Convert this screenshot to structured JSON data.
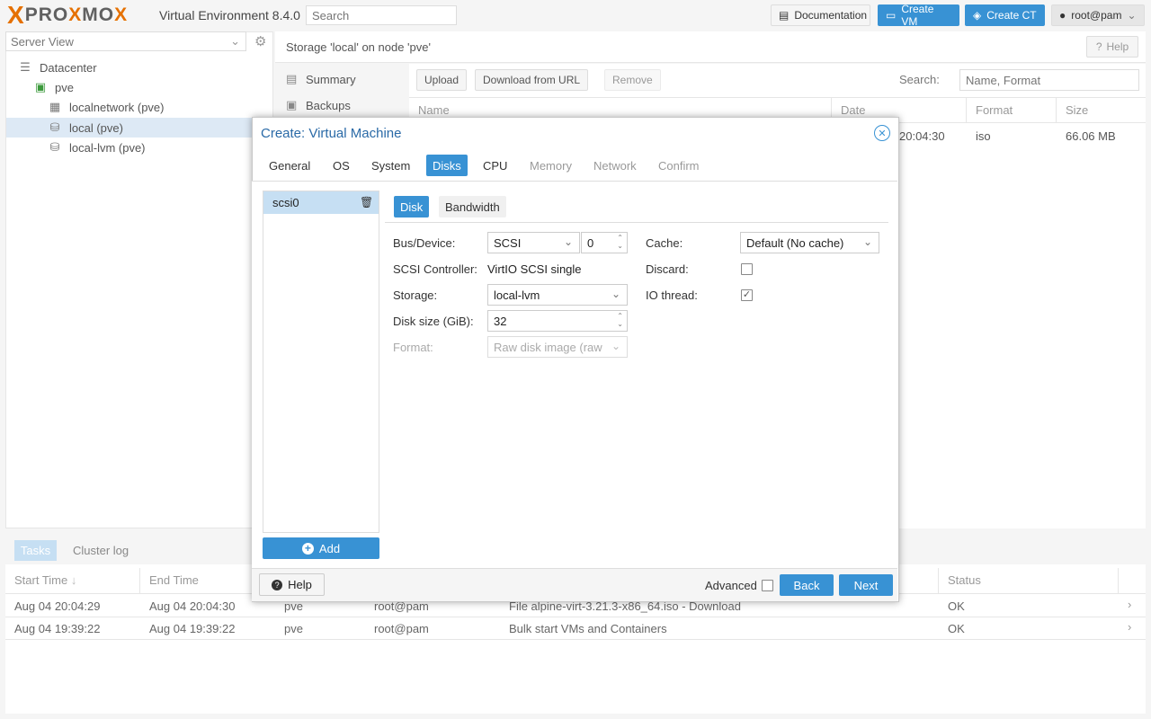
{
  "topbar": {
    "logo_x": "X",
    "brand": "PROXMOX",
    "version": "Virtual Environment 8.4.0",
    "search_placeholder": "Search",
    "documentation": "Documentation",
    "create_vm": "Create VM",
    "create_ct": "Create CT",
    "user": "root@pam"
  },
  "sidebar": {
    "view": "Server View",
    "tree": [
      {
        "label": "Datacenter",
        "icon": "server-rack-icon"
      },
      {
        "label": "pve",
        "icon": "node-icon"
      },
      {
        "label": "localnetwork (pve)",
        "icon": "network-grid-icon"
      },
      {
        "label": "local (pve)",
        "icon": "storage-icon"
      },
      {
        "label": "local-lvm (pve)",
        "icon": "storage-icon"
      }
    ]
  },
  "content": {
    "breadcrumb": "Storage 'local' on node 'pve'",
    "help": "Help",
    "nav": [
      {
        "label": "Summary",
        "icon": "book-icon"
      },
      {
        "label": "Backups",
        "icon": "floppy-icon"
      }
    ],
    "toolbar": {
      "upload": "Upload",
      "download_url": "Download from URL",
      "remove": "Remove",
      "search_label": "Search:",
      "search_placeholder": "Name, Format"
    },
    "columns": {
      "name": "Name",
      "date": "Date",
      "format": "Format",
      "size": "Size"
    },
    "row": {
      "date": "20:04:30",
      "format": "iso",
      "size": "66.06 MB"
    }
  },
  "tasks": {
    "tabs": {
      "tasks": "Tasks",
      "cluster_log": "Cluster log"
    },
    "columns": {
      "start": "Start Time",
      "sort": "↓",
      "end": "End Time",
      "status": "Status"
    },
    "rows": [
      {
        "start": "Aug 04 20:04:29",
        "end": "Aug 04 20:04:30",
        "node": "pve",
        "user": "root@pam",
        "desc": "File alpine-virt-3.21.3-x86_64.iso - Download",
        "status": "OK"
      },
      {
        "start": "Aug 04 19:39:22",
        "end": "Aug 04 19:39:22",
        "node": "pve",
        "user": "root@pam",
        "desc": "Bulk start VMs and Containers",
        "status": "OK"
      }
    ]
  },
  "modal": {
    "title": "Create: Virtual Machine",
    "tabs": [
      {
        "label": "General",
        "state": "normal"
      },
      {
        "label": "OS",
        "state": "normal"
      },
      {
        "label": "System",
        "state": "normal"
      },
      {
        "label": "Disks",
        "state": "active"
      },
      {
        "label": "CPU",
        "state": "normal"
      },
      {
        "label": "Memory",
        "state": "disabled"
      },
      {
        "label": "Network",
        "state": "disabled"
      },
      {
        "label": "Confirm",
        "state": "disabled"
      }
    ],
    "disk_item": "scsi0",
    "add": "Add",
    "subtabs": {
      "disk": "Disk",
      "bandwidth": "Bandwidth"
    },
    "fields": {
      "bus_label": "Bus/Device:",
      "bus_value": "SCSI",
      "device_value": "0",
      "controller_label": "SCSI Controller:",
      "controller_value": "VirtIO SCSI single",
      "storage_label": "Storage:",
      "storage_value": "local-lvm",
      "size_label": "Disk size (GiB):",
      "size_value": "32",
      "format_label": "Format:",
      "format_value": "Raw disk image (raw",
      "cache_label": "Cache:",
      "cache_value": "Default (No cache)",
      "discard_label": "Discard:",
      "discard_checked": false,
      "iothread_label": "IO thread:",
      "iothread_checked": true
    },
    "footer": {
      "help": "Help",
      "advanced": "Advanced",
      "back": "Back",
      "next": "Next"
    }
  },
  "colors": {
    "accent": "#3892d4",
    "brand_orange": "#e57000",
    "selection": "#c6dff3"
  }
}
